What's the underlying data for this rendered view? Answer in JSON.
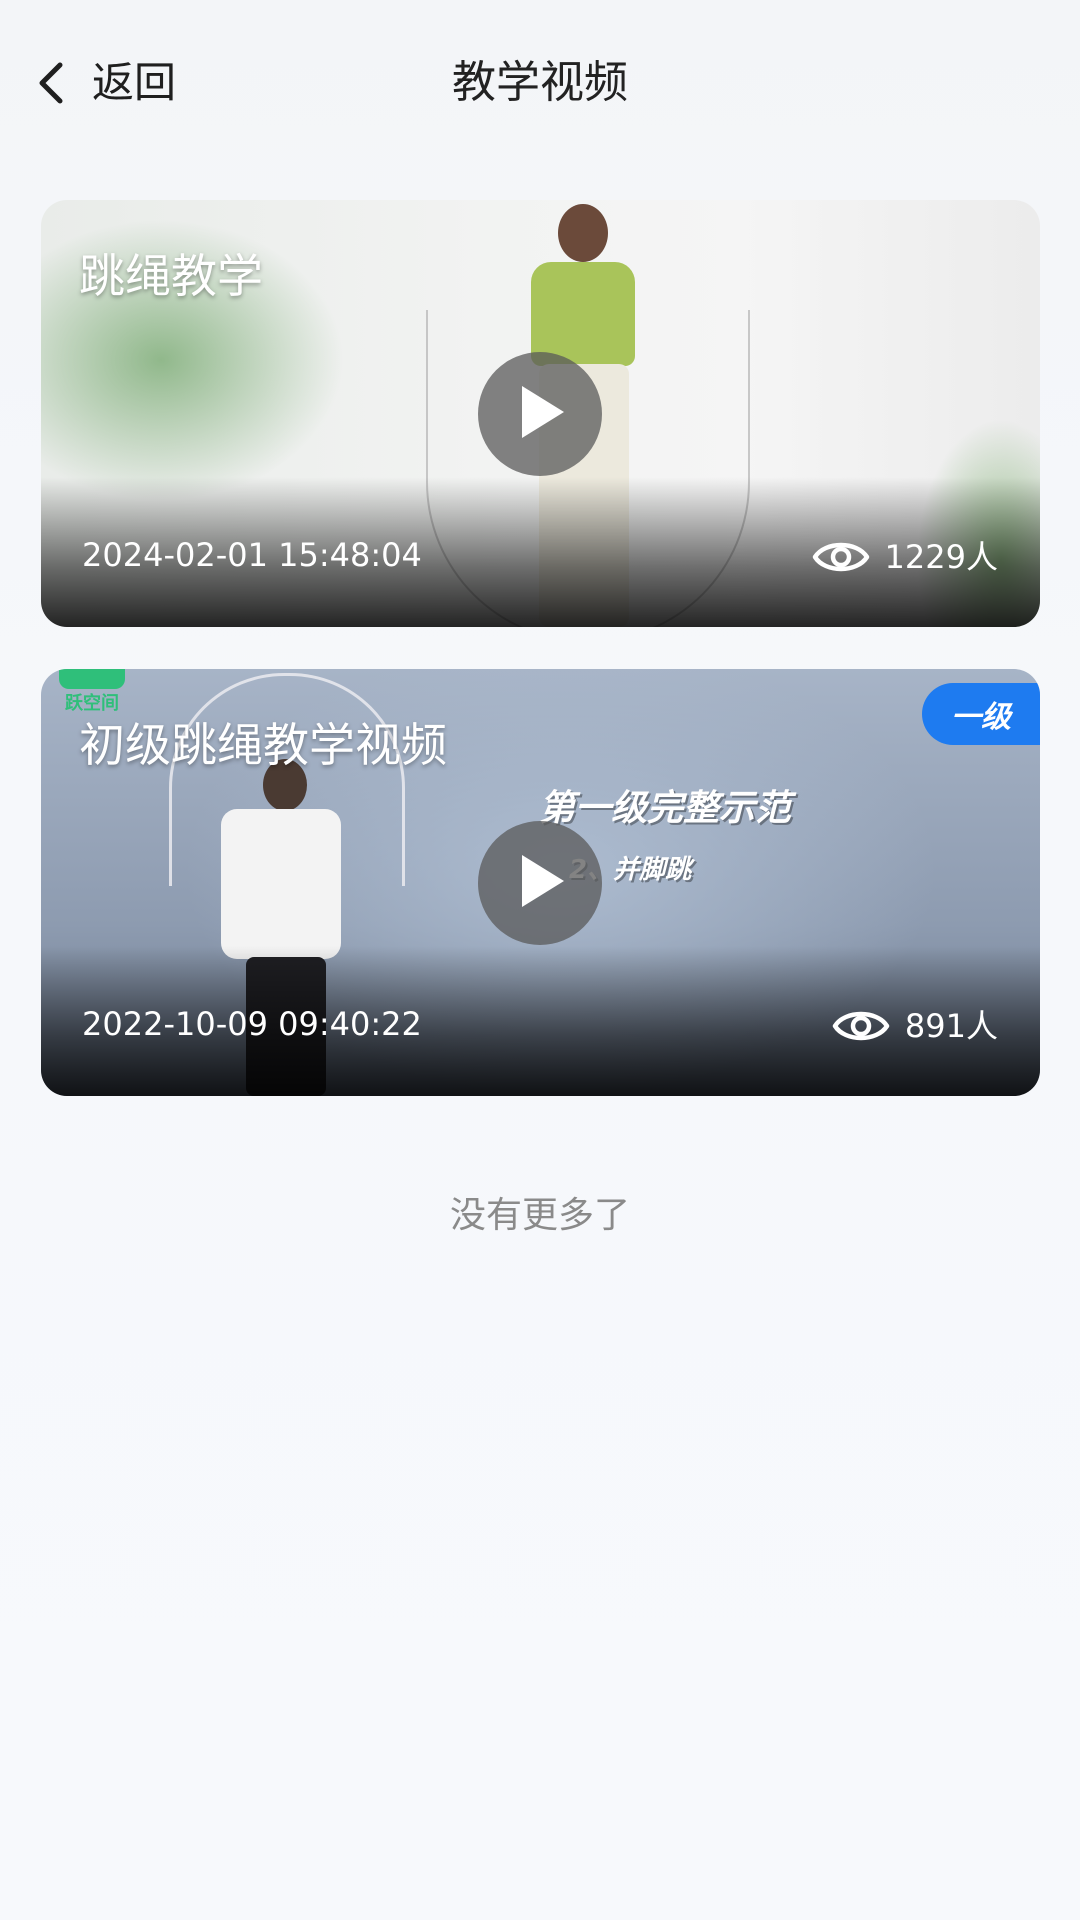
{
  "header": {
    "back_label": "返回",
    "title": "教学视频"
  },
  "videos": [
    {
      "title": "跳绳教学",
      "date": "2024-02-01 15:48:04",
      "views": "1229人"
    },
    {
      "title": "初级跳绳教学视频",
      "date": "2022-10-09 09:40:22",
      "views": "891人",
      "badge": "一级",
      "overlay_line1": "第一级完整示范",
      "overlay_line2": "2、并脚跳",
      "brand": "跃空间"
    }
  ],
  "footer": {
    "no_more": "没有更多了"
  },
  "colors": {
    "badge_blue": "#1e7bf0",
    "brand_green": "#2fbf7a"
  },
  "icons": {
    "back": "chevron-left-icon",
    "play": "play-icon",
    "views": "eye-icon"
  }
}
